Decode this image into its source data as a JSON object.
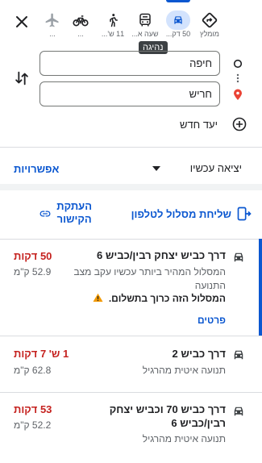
{
  "modes": [
    {
      "name": "best",
      "label": "מומלץ"
    },
    {
      "name": "driving",
      "label": "50 דק...",
      "tooltip": "נהיגה"
    },
    {
      "name": "transit",
      "label": "שעה א..."
    },
    {
      "name": "walking",
      "label": "11 ש'..."
    },
    {
      "name": "cycling",
      "label": "..."
    },
    {
      "name": "flight",
      "label": "..."
    }
  ],
  "origin": "חיפה",
  "destination": "חריש",
  "add_destination": "יעד חדש",
  "depart_option": "יציאה עכשיו",
  "options_label": "אפשרויות",
  "send_to_phone": "שליחת מסלול לטלפון",
  "copy_link": [
    "העתקת",
    "הקישור"
  ],
  "routes": [
    {
      "title": "דרך כביש יצחק רבין/כביש 6",
      "desc": [
        "המסלול המהיר ביותר עכשיו עקב מצב",
        "התנועה"
      ],
      "warning": "המסלול הזה כרוך בתשלום.",
      "details": "פרטים",
      "time": "50 דקות",
      "distance": "52.9 ק\"מ"
    },
    {
      "title": "דרך כביש 2",
      "desc": [
        "תנועה איטית מהרגיל"
      ],
      "time": "1 ש' 7 דקות",
      "distance": "62.8 ק\"מ"
    },
    {
      "title": [
        "דרך כביש 70 וכביש יצחק",
        "רבין/כביש 6"
      ],
      "desc": [
        "תנועה איטית מהרגיל"
      ],
      "time": "53 דקות",
      "distance": "52.2 ק\"מ"
    }
  ],
  "colors": {
    "accent": "#0b57d0",
    "time": "#c5221f",
    "warning": "#f29900"
  }
}
